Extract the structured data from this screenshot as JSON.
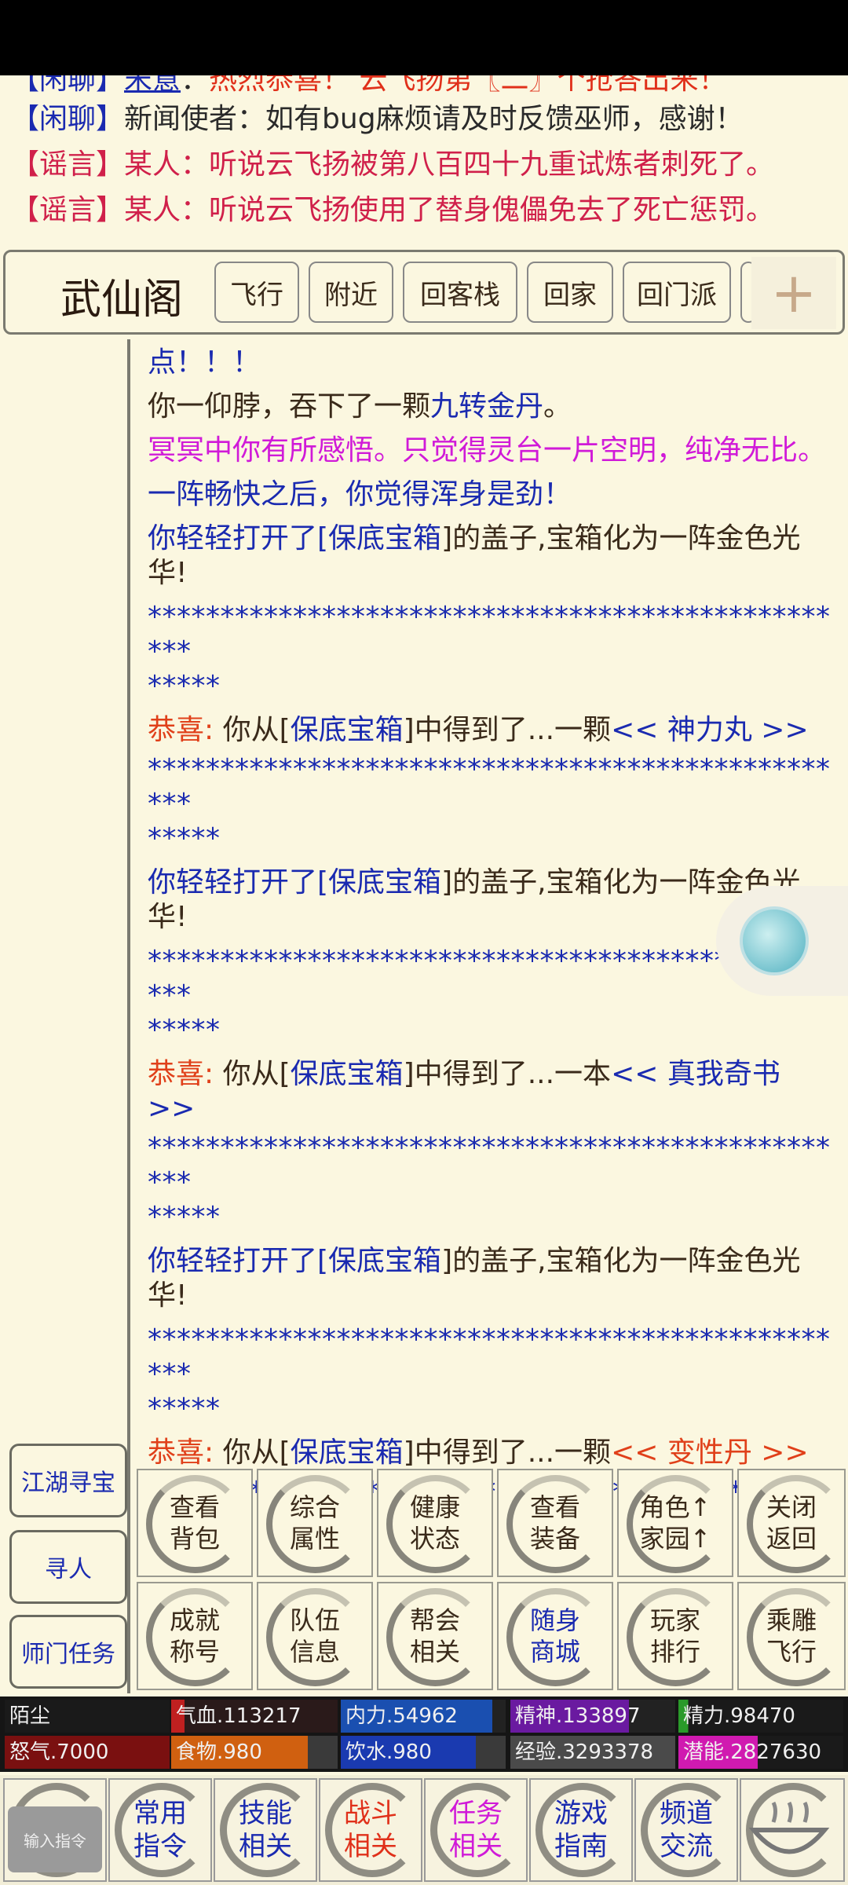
{
  "chat": [
    {
      "tag": "【闲聊】",
      "name": "宋意",
      "sep": "：",
      "msg": "热烈恭喜！ 云飞扬第〖二〗个抢答出来！"
    },
    {
      "tag": "【闲聊】",
      "name": "新闻使者",
      "sep": "：",
      "msg": "如有bug麻烦请及时反馈巫师，感谢！"
    },
    {
      "tag": "【谣言】",
      "name": "某人",
      "sep": "：",
      "msg": "听说云飞扬被第八百四十九重试炼者刺死了。"
    },
    {
      "tag": "【谣言】",
      "name": "某人",
      "sep": "：",
      "msg": "听说云飞扬使用了替身傀儡免去了死亡惩罚。"
    }
  ],
  "header": {
    "title": "武仙阁",
    "buttons": [
      "飞行",
      "附近",
      "回客栈",
      "回家",
      "回门派"
    ],
    "plus": "+"
  },
  "side": [
    "江湖寻宝",
    "寻人",
    "师门任务"
  ],
  "log": {
    "l1": "点！！！",
    "l2a": "你一仰脖，吞下了一颗",
    "l2b": "九转金丹",
    "l2c": "。",
    "l3": "冥冥中你有所感悟。只觉得灵台一片空明，纯净无比。",
    "l4": "一阵畅快之后，你觉得浑身是劲！",
    "open_a": "你轻轻打开了[",
    "box": "保底宝箱",
    "open_b": "]的盖子,宝箱化为一阵金色光华!",
    "stars": "**************************************************",
    "congrats": "恭喜:",
    "get_a": " 你从[",
    "get_b": "]中得到了...",
    "item1_pre": "一颗",
    "item1": "<< 神力丸 >>",
    "item2_pre": "一本",
    "item2": "<< 真我奇书 >>",
    "item3_pre": "一颗",
    "item3": "<< 变性丹 >>"
  },
  "grid": [
    "查看\n背包",
    "综合\n属性",
    "健康\n状态",
    "查看\n装备",
    "角色↑\n家园↑",
    "关闭\n返回",
    "成就\n称号",
    "队伍\n信息",
    "帮会\n相关",
    "随身\n商城",
    "玩家\n排行",
    "乘雕\n飞行"
  ],
  "stats": {
    "name": "陌尘",
    "hp": "气血.113217",
    "neili": "内力.54962",
    "jingshen": "精神.133897",
    "jingli": "精力.98470",
    "nuqi": "怒气.7000",
    "food": "食物.980",
    "water": "饮水.980",
    "exp": "经验.3293378",
    "potential": "潜能.2827630"
  },
  "nav": {
    "input": "输入指令",
    "items": [
      "常用\n指令",
      "技能\n相关",
      "战斗\n相关",
      "任务\n相关",
      "游戏\n指南",
      "频道\n交流"
    ]
  },
  "colors": {
    "bg": "#fbf7e0",
    "blue": "#1a2ab0",
    "magenta": "#d01ad8",
    "orange": "#e0401a",
    "rumor": "#d0204a"
  }
}
